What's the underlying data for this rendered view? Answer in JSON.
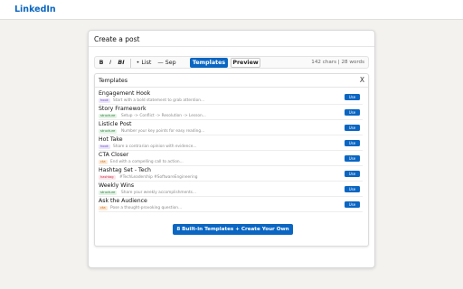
{
  "app": {
    "logo": "LinkedIn"
  },
  "card": {
    "title": "Create a post"
  },
  "toolbar": {
    "bold": "B",
    "italic": "I",
    "bold_italic": "BI",
    "list": "• List",
    "sep": "— Sep",
    "templates": "Templates",
    "preview": "Preview",
    "count": "142 chars | 28 words"
  },
  "templates_panel": {
    "title": "Templates",
    "close": "X",
    "use_label": "Use",
    "items": [
      {
        "name": "Engagement Hook",
        "tag": "hook",
        "tag_kind": "hook",
        "desc": "Start with a bold statement to grab attention..."
      },
      {
        "name": "Story Framework",
        "tag": "structure",
        "tag_kind": "structure",
        "desc": "Setup -> Conflict -> Resolution -> Lesson..."
      },
      {
        "name": "Listicle Post",
        "tag": "structure",
        "tag_kind": "structure",
        "desc": "Number your key points for easy reading..."
      },
      {
        "name": "Hot Take",
        "tag": "hook",
        "tag_kind": "hook",
        "desc": "Share a contrarian opinion with evidence..."
      },
      {
        "name": "CTA Closer",
        "tag": "cta",
        "tag_kind": "cta",
        "desc": "End with a compelling call to action..."
      },
      {
        "name": "Hashtag Set - Tech",
        "tag": "hashtag",
        "tag_kind": "hashtag",
        "desc": "#TechLeadership #SoftwareEngineering"
      },
      {
        "name": "Weekly Wins",
        "tag": "structure",
        "tag_kind": "structure",
        "desc": "Share your weekly accomplishments..."
      },
      {
        "name": "Ask the Audience",
        "tag": "cta",
        "tag_kind": "cta",
        "desc": "Pose a thought-provoking question..."
      }
    ]
  },
  "footer_button": {
    "label": "8 Built-in Templates + Create Your Own"
  },
  "colors": {
    "brand": "#0a66c2",
    "background": "#f3f2ef"
  }
}
